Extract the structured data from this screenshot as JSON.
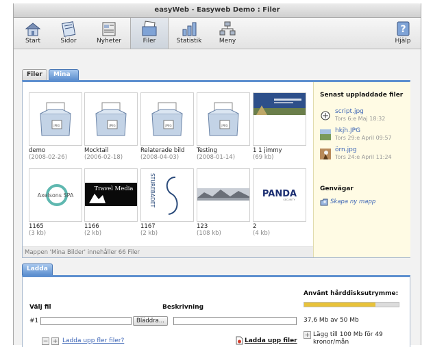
{
  "window": {
    "title": "easyWeb - Easyweb Demo : Filer"
  },
  "toolbar": {
    "items": [
      {
        "label": "Start",
        "icon": "house-icon"
      },
      {
        "label": "Sidor",
        "icon": "pages-icon"
      },
      {
        "label": "Nyheter",
        "icon": "news-icon"
      },
      {
        "label": "Filer",
        "icon": "files-icon",
        "active": true
      },
      {
        "label": "Statistik",
        "icon": "statistics-icon"
      },
      {
        "label": "Meny",
        "icon": "menu-icon"
      },
      {
        "label": "Hjälp",
        "icon": "help-icon"
      }
    ]
  },
  "tabs": {
    "files": "Filer",
    "my_images": "Mina Bilder"
  },
  "grid": {
    "items": [
      {
        "name": "demo",
        "meta": "(2008-02-26)",
        "kind": "folder"
      },
      {
        "name": "Mocktail",
        "meta": "(2006-02-18)",
        "kind": "folder"
      },
      {
        "name": "Relaterade bild",
        "meta": "(2008-04-03)",
        "kind": "folder"
      },
      {
        "name": "Testing",
        "meta": "(2008-01-14)",
        "kind": "folder"
      },
      {
        "name": "1 1 jimmy",
        "meta": "(69 kb)",
        "kind": "photo"
      },
      {
        "name": "1165",
        "meta": "(3 kb)",
        "kind": "axelsons",
        "logo_text": "Axelsons SPA"
      },
      {
        "name": "1166",
        "meta": "(2 kb)",
        "kind": "travel",
        "logo_text": "Travel Media"
      },
      {
        "name": "1167",
        "meta": "(2 kb)",
        "kind": "sturebadet",
        "logo_text": "STUREBADET"
      },
      {
        "name": "123",
        "meta": "(108 kb)",
        "kind": "landscape"
      },
      {
        "name": "2",
        "meta": "(4 kb)",
        "kind": "panda",
        "logo_text": "PANDA",
        "logo_sub": "SECURITY"
      }
    ],
    "folder_badge": "JPEG",
    "status": "Mappen 'Mina Bilder' innehåller 66 Filer"
  },
  "sidebar": {
    "recent_title": "Senast uppladdade filer",
    "recent": [
      {
        "name": "script.jpg",
        "date": "Tors 6:e Maj 18:32"
      },
      {
        "name": "hkjh.JPG",
        "date": "Tors 29:e April 09:57"
      },
      {
        "name": "örn.jpg",
        "date": "Tors 24:e April 11:24"
      }
    ],
    "shortcuts_title": "Genvägar",
    "new_folder": "Skapa ny mapp"
  },
  "upload": {
    "tab": "Ladda upp filer",
    "choose_file": "Välj fil",
    "description": "Beskrivning",
    "row_no": "#1",
    "browse": "Bläddra...",
    "minus": "−",
    "plus": "+",
    "more_files": "Ladda upp fler filer?",
    "upload_files": "Ladda upp filer",
    "disk_title": "Använt hårddisksutrymme:",
    "disk_used_fraction": 0.75,
    "disk_text": "37,6 Mb av 50 Mb",
    "add_storage": "Lägg till 100 Mb för 49 kronor/mån"
  },
  "colors": {
    "accent": "#5d8fcf",
    "link": "#3a63b5",
    "disk_bar": "#e8c23a"
  }
}
